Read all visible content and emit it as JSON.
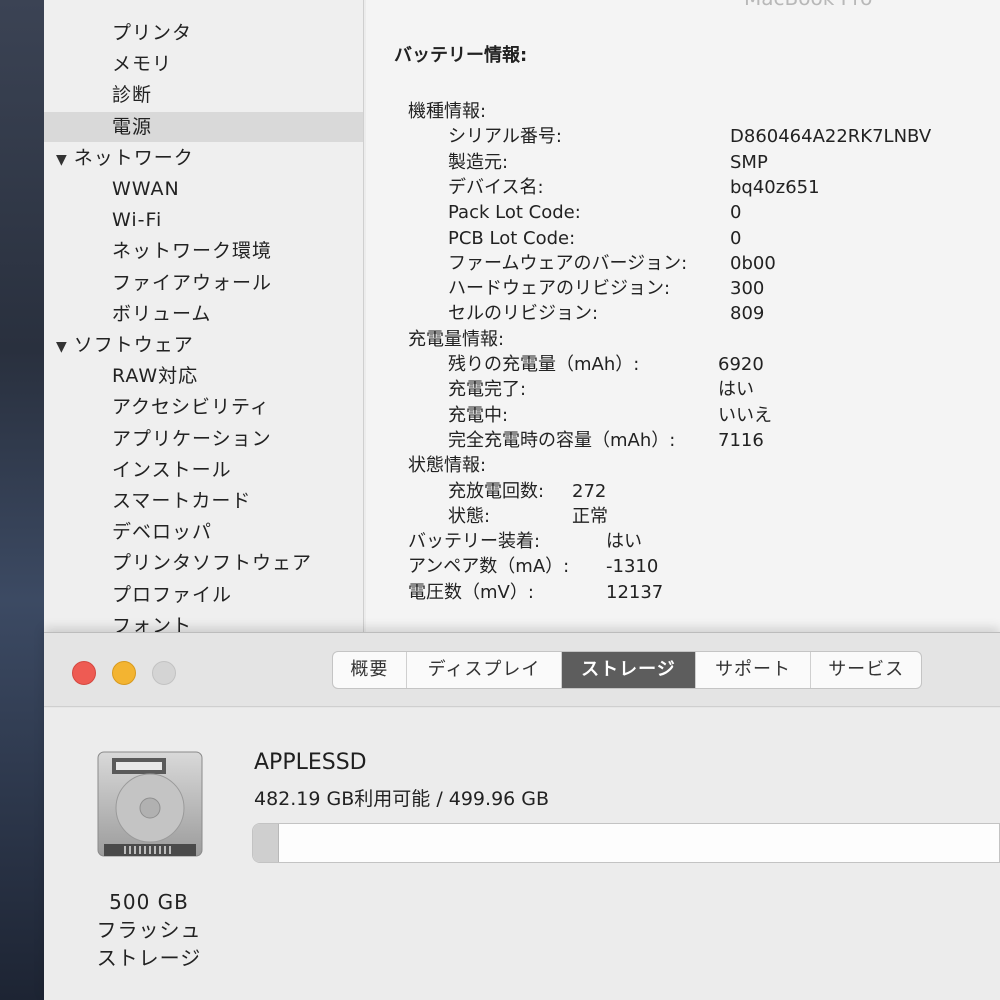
{
  "sysinfo": {
    "window_title": "MacBook Pro",
    "sidebar": [
      {
        "label": "プリンタ",
        "type": "child"
      },
      {
        "label": "メモリ",
        "type": "child"
      },
      {
        "label": "診断",
        "type": "child"
      },
      {
        "label": "電源",
        "type": "child",
        "selected": true
      },
      {
        "label": "ネットワーク",
        "type": "group"
      },
      {
        "label": "WWAN",
        "type": "child"
      },
      {
        "label": "Wi-Fi",
        "type": "child"
      },
      {
        "label": "ネットワーク環境",
        "type": "child"
      },
      {
        "label": "ファイアウォール",
        "type": "child"
      },
      {
        "label": "ボリューム",
        "type": "child"
      },
      {
        "label": "ソフトウェア",
        "type": "group"
      },
      {
        "label": "RAW対応",
        "type": "child"
      },
      {
        "label": "アクセシビリティ",
        "type": "child"
      },
      {
        "label": "アプリケーション",
        "type": "child"
      },
      {
        "label": "インストール",
        "type": "child"
      },
      {
        "label": "スマートカード",
        "type": "child"
      },
      {
        "label": "デベロッパ",
        "type": "child"
      },
      {
        "label": "プリンタソフトウェア",
        "type": "child"
      },
      {
        "label": "プロファイル",
        "type": "child"
      },
      {
        "label": "フォント",
        "type": "child"
      }
    ],
    "battery": {
      "title": "バッテリー情報:",
      "model_heading": "機種情報:",
      "model": [
        {
          "label": "シリアル番号:",
          "value": "D860464A22RK7LNBV"
        },
        {
          "label": "製造元:",
          "value": "SMP"
        },
        {
          "label": "デバイス名:",
          "value": "bq40z651"
        },
        {
          "label": "Pack Lot Code:",
          "value": "0"
        },
        {
          "label": "PCB Lot Code:",
          "value": "0"
        },
        {
          "label": "ファームウェアのバージョン:",
          "value": "0b00"
        },
        {
          "label": "ハードウェアのリビジョン:",
          "value": "300"
        },
        {
          "label": "セルのリビジョン:",
          "value": "809"
        }
      ],
      "charge_heading": "充電量情報:",
      "charge": [
        {
          "label": "残りの充電量（mAh）:",
          "value": "6920"
        },
        {
          "label": "充電完了:",
          "value": "はい"
        },
        {
          "label": "充電中:",
          "value": "いいえ"
        },
        {
          "label": "完全充電時の容量（mAh）:",
          "value": "7116"
        }
      ],
      "health_heading": "状態情報:",
      "health": [
        {
          "label": "充放電回数:",
          "value": "272"
        },
        {
          "label": "状態:",
          "value": "正常"
        }
      ],
      "extra": [
        {
          "label": "バッテリー装着:",
          "value": "はい"
        },
        {
          "label": "アンペア数（mA）:",
          "value": "-1310"
        },
        {
          "label": "電圧数（mV）:",
          "value": "12137"
        }
      ]
    }
  },
  "about": {
    "tabs": [
      "概要",
      "ディスプレイ",
      "ストレージ",
      "サポート",
      "サービス"
    ],
    "active_tab": "ストレージ",
    "drive": {
      "name": "APPLESSD",
      "space_text": "482.19 GB利用可能 / 499.96 GB",
      "used_fraction": 0.0355,
      "caption": [
        "500 GB",
        "フラッシュ",
        "ストレージ"
      ]
    }
  }
}
